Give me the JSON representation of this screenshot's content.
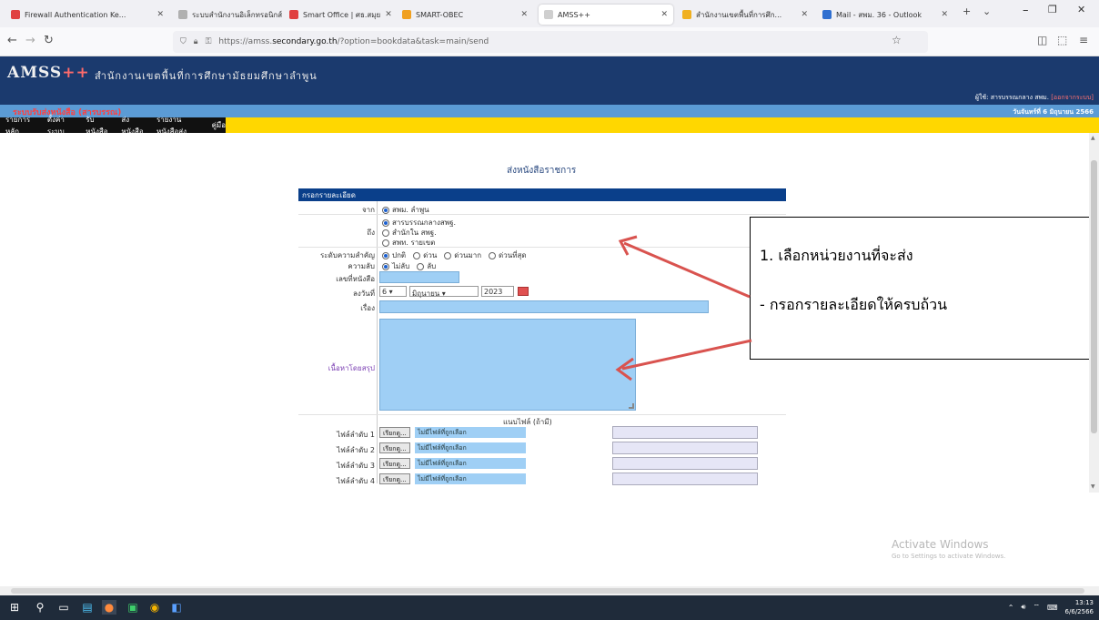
{
  "browser": {
    "tabs": [
      {
        "label": "Firewall Authentication Ke...",
        "color": "#e04040"
      },
      {
        "label": "ระบบสำนักงานอิเล็กทรอนิกส์ ::",
        "color": "#b0b0b0"
      },
      {
        "label": "Smart Office | ศธ.สมุย",
        "color": "#e04040"
      },
      {
        "label": "SMART-OBEC",
        "color": "#f0a020"
      },
      {
        "label": "AMSS++",
        "color": "#cfcfcf"
      },
      {
        "label": "สำนักงานเขตพื้นที่การศึก...",
        "color": "#f0b020"
      },
      {
        "label": "Mail - สพม. 36 - Outlook",
        "color": "#2f6fd0"
      }
    ],
    "url_prefix": "https://amss.",
    "url_domain": "secondary.go.th",
    "url_suffix": "/?option=bookdata&task=main/send"
  },
  "site": {
    "logo": "AMSS",
    "logo_plus": "++",
    "org_name": "สำนักงานเขตพื้นที่การศึกษามัธยมศึกษาลำพูน",
    "user_prefix": "ผู้ใช้: สารบรรณกลาง สพม.",
    "user_name": "[ออกจากระบบ]",
    "system_title": "ระบบรับส่งหนังสือ (สารบรรณ)",
    "date": "วันจันทร์ที่ 6 มิถุนายน 2566",
    "menu": [
      "รายการหลัก",
      "ตั้งค่าระบบ",
      "รับหนังสือ",
      "ส่งหนังสือ",
      "รายงานหนังสือส่ง",
      "คู่มือ"
    ]
  },
  "form": {
    "page_title": "ส่งหนังสือราชการ",
    "header": "กรอกรายละเอียด",
    "labels": {
      "from": "จาก",
      "to": "ถึง",
      "priority": "ระดับความสำคัญ",
      "secret": "ความลับ",
      "book_no": "เลขที่หนังสือ",
      "date": "ลงวันที่",
      "subject": "เรื่อง",
      "detail": "เนื้อหาโดยสรุป",
      "attach_head": "แนบไฟล์ (ถ้ามี)"
    },
    "from_option": "สพม. ลำพูน",
    "to_options": [
      "สารบรรณกลางสพฐ.",
      "สำนักใน สพฐ.",
      "สพท. รายเขต"
    ],
    "priority_options": [
      "ปกติ",
      "ด่วน",
      "ด่วนมาก",
      "ด่วนที่สุด"
    ],
    "secret_options": [
      "ไม่ลับ",
      "ลับ"
    ],
    "date_day": "6",
    "date_month": "มิถุนายน",
    "date_year": "2023",
    "attach_rows": [
      {
        "label": "ไฟล์ลำดับ 1",
        "button": "เรียกดู...",
        "filename": "ไม่มีไฟล์ที่ถูกเลือก"
      },
      {
        "label": "ไฟล์ลำดับ 2",
        "button": "เรียกดู...",
        "filename": "ไม่มีไฟล์ที่ถูกเลือก"
      },
      {
        "label": "ไฟล์ลำดับ 3",
        "button": "เรียกดู...",
        "filename": "ไม่มีไฟล์ที่ถูกเลือก"
      },
      {
        "label": "ไฟล์ลำดับ 4",
        "button": "เรียกดู...",
        "filename": "ไม่มีไฟล์ที่ถูกเลือก"
      }
    ]
  },
  "callout": {
    "line1": "1. เลือกหน่วยงานที่จะส่ง",
    "line2": "- กรอกรายละเอียดให้ครบถ้วน",
    "arrow_color": "#d9534f"
  },
  "watermark": {
    "line1": "Activate Windows",
    "line2": "Go to Settings to activate Windows."
  },
  "taskbar": {
    "time": "13:13",
    "date": "6/6/2566"
  }
}
